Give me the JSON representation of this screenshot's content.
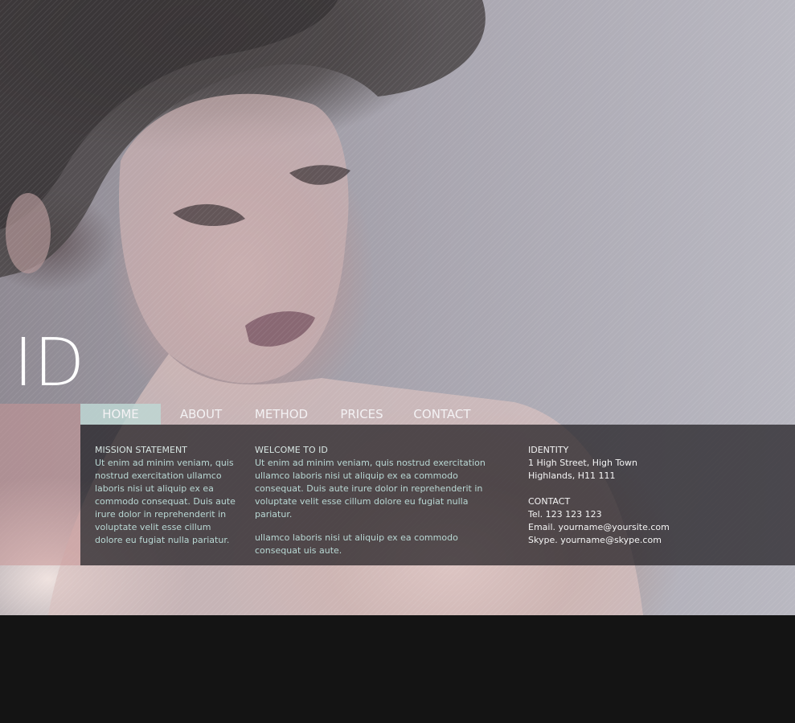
{
  "logo": {
    "text": "ID"
  },
  "nav": {
    "items": [
      {
        "label": "HOME",
        "active": true
      },
      {
        "label": "ABOUT",
        "active": false
      },
      {
        "label": "METHOD",
        "active": false
      },
      {
        "label": "PRICES",
        "active": false
      },
      {
        "label": "CONTACT",
        "active": false
      }
    ]
  },
  "mission": {
    "title": "MISSION STATEMENT",
    "text": "Ut enim ad minim veniam, quis nostrud exercitation ullamco laboris nisi ut aliquip ex ea commodo consequat. Duis aute irure dolor in reprehenderit in voluptate velit esse cillum dolore eu fugiat nulla pariatur."
  },
  "welcome": {
    "title": "WELCOME TO ID",
    "text1": "Ut enim ad minim veniam, quis nostrud exercitation ullamco laboris nisi ut aliquip ex ea commodo consequat. Duis aute irure dolor in reprehenderit in voluptate velit esse cillum dolore eu fugiat nulla pariatur.",
    "text2": "ullamco laboris nisi ut aliquip ex ea commodo consequat uis aute."
  },
  "identity": {
    "title": "IDENTITY",
    "address_line1": "1 High Street, High Town",
    "address_line2": "Highlands, H11 111"
  },
  "contact": {
    "title": "CONTACT",
    "tel": "Tel. 123 123 123",
    "email": "Email. yourname@yoursite.com",
    "skype": "Skype. yourname@skype.com"
  },
  "colors": {
    "nav_active_bg": "#bed7d4",
    "accent_pink": "#c89696",
    "panel_bg": "#1e1c20",
    "text_teal": "#b9d8d4",
    "footer_bg": "#141414"
  }
}
